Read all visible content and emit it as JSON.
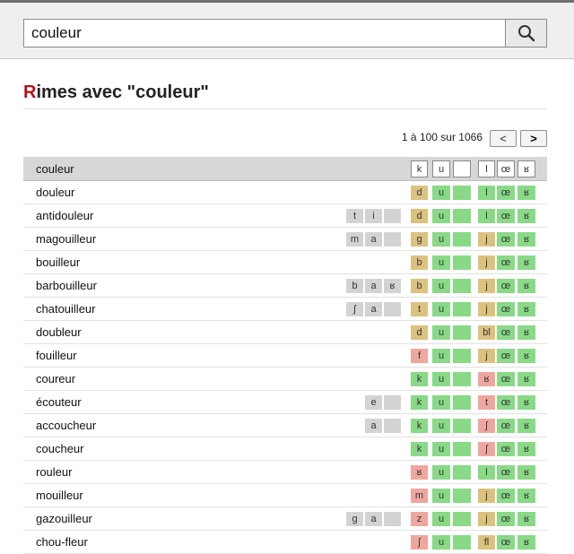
{
  "search": {
    "value": "couleur",
    "placeholder": ""
  },
  "title": {
    "first_letter": "R",
    "rest": "imes avec \"couleur\""
  },
  "pager": {
    "summary": "1 à 100 sur 1066",
    "prev_label": "<",
    "next_label": ">"
  },
  "colors": {
    "gray": "#d3d3d3",
    "tan": "#dcc27f",
    "green": "#89d987",
    "red": "#eea79f",
    "title_accent": "#b3141b"
  },
  "header_row": {
    "word": "couleur",
    "phonemes": [
      "",
      "",
      "",
      "k",
      "u",
      "",
      "l",
      "œ",
      "ʁ"
    ]
  },
  "rows": [
    {
      "word": "douleur",
      "cells": [
        [
          "",
          ""
        ],
        [
          "",
          ""
        ],
        [
          "",
          ""
        ],
        [
          "d",
          "tan"
        ],
        [
          "u",
          "green"
        ],
        [
          "",
          "green"
        ],
        [
          "l",
          "green"
        ],
        [
          "œ",
          "green"
        ],
        [
          "ʁ",
          "green"
        ]
      ]
    },
    {
      "word": "antidouleur",
      "cells": [
        [
          "t",
          "gray"
        ],
        [
          "i",
          "gray"
        ],
        [
          "",
          "gray"
        ],
        [
          "d",
          "tan"
        ],
        [
          "u",
          "green"
        ],
        [
          "",
          "green"
        ],
        [
          "l",
          "green"
        ],
        [
          "œ",
          "green"
        ],
        [
          "ʁ",
          "green"
        ]
      ]
    },
    {
      "word": "magouilleur",
      "cells": [
        [
          "m",
          "gray"
        ],
        [
          "a",
          "gray"
        ],
        [
          "",
          "gray"
        ],
        [
          "g",
          "tan"
        ],
        [
          "u",
          "green"
        ],
        [
          "",
          "green"
        ],
        [
          "j",
          "tan"
        ],
        [
          "œ",
          "green"
        ],
        [
          "ʁ",
          "green"
        ]
      ]
    },
    {
      "word": "bouilleur",
      "cells": [
        [
          "",
          ""
        ],
        [
          "",
          ""
        ],
        [
          "",
          ""
        ],
        [
          "b",
          "tan"
        ],
        [
          "u",
          "green"
        ],
        [
          "",
          "green"
        ],
        [
          "j",
          "tan"
        ],
        [
          "œ",
          "green"
        ],
        [
          "ʁ",
          "green"
        ]
      ]
    },
    {
      "word": "barbouilleur",
      "cells": [
        [
          "b",
          "gray"
        ],
        [
          "a",
          "gray"
        ],
        [
          "ʁ",
          "gray"
        ],
        [
          "b",
          "tan"
        ],
        [
          "u",
          "green"
        ],
        [
          "",
          "green"
        ],
        [
          "j",
          "tan"
        ],
        [
          "œ",
          "green"
        ],
        [
          "ʁ",
          "green"
        ]
      ]
    },
    {
      "word": "chatouilleur",
      "cells": [
        [
          "ʃ",
          "gray"
        ],
        [
          "a",
          "gray"
        ],
        [
          "",
          "gray"
        ],
        [
          "t",
          "tan"
        ],
        [
          "u",
          "green"
        ],
        [
          "",
          "green"
        ],
        [
          "j",
          "tan"
        ],
        [
          "œ",
          "green"
        ],
        [
          "ʁ",
          "green"
        ]
      ]
    },
    {
      "word": "doubleur",
      "cells": [
        [
          "",
          ""
        ],
        [
          "",
          ""
        ],
        [
          "",
          ""
        ],
        [
          "d",
          "tan"
        ],
        [
          "u",
          "green"
        ],
        [
          "",
          "green"
        ],
        [
          "bl",
          "tan"
        ],
        [
          "œ",
          "green"
        ],
        [
          "ʁ",
          "green"
        ]
      ]
    },
    {
      "word": "fouilleur",
      "cells": [
        [
          "",
          ""
        ],
        [
          "",
          ""
        ],
        [
          "",
          ""
        ],
        [
          "f",
          "red"
        ],
        [
          "u",
          "green"
        ],
        [
          "",
          "green"
        ],
        [
          "j",
          "tan"
        ],
        [
          "œ",
          "green"
        ],
        [
          "ʁ",
          "green"
        ]
      ]
    },
    {
      "word": "coureur",
      "cells": [
        [
          "",
          ""
        ],
        [
          "",
          ""
        ],
        [
          "",
          ""
        ],
        [
          "k",
          "green"
        ],
        [
          "u",
          "green"
        ],
        [
          "",
          "green"
        ],
        [
          "ʁ",
          "red"
        ],
        [
          "œ",
          "green"
        ],
        [
          "ʁ",
          "green"
        ]
      ]
    },
    {
      "word": "écouteur",
      "cells": [
        [
          "",
          ""
        ],
        [
          "e",
          "gray"
        ],
        [
          "",
          "gray"
        ],
        [
          "k",
          "green"
        ],
        [
          "u",
          "green"
        ],
        [
          "",
          "green"
        ],
        [
          "t",
          "red"
        ],
        [
          "œ",
          "green"
        ],
        [
          "ʁ",
          "green"
        ]
      ]
    },
    {
      "word": "accoucheur",
      "cells": [
        [
          "",
          ""
        ],
        [
          "a",
          "gray"
        ],
        [
          "",
          "gray"
        ],
        [
          "k",
          "green"
        ],
        [
          "u",
          "green"
        ],
        [
          "",
          "green"
        ],
        [
          "ʃ",
          "red"
        ],
        [
          "œ",
          "green"
        ],
        [
          "ʁ",
          "green"
        ]
      ]
    },
    {
      "word": "coucheur",
      "cells": [
        [
          "",
          ""
        ],
        [
          "",
          ""
        ],
        [
          "",
          ""
        ],
        [
          "k",
          "green"
        ],
        [
          "u",
          "green"
        ],
        [
          "",
          "green"
        ],
        [
          "ʃ",
          "red"
        ],
        [
          "œ",
          "green"
        ],
        [
          "ʁ",
          "green"
        ]
      ]
    },
    {
      "word": "rouleur",
      "cells": [
        [
          "",
          ""
        ],
        [
          "",
          ""
        ],
        [
          "",
          ""
        ],
        [
          "ʁ",
          "red"
        ],
        [
          "u",
          "green"
        ],
        [
          "",
          "green"
        ],
        [
          "l",
          "green"
        ],
        [
          "œ",
          "green"
        ],
        [
          "ʁ",
          "green"
        ]
      ]
    },
    {
      "word": "mouilleur",
      "cells": [
        [
          "",
          ""
        ],
        [
          "",
          ""
        ],
        [
          "",
          ""
        ],
        [
          "m",
          "red"
        ],
        [
          "u",
          "green"
        ],
        [
          "",
          "green"
        ],
        [
          "j",
          "tan"
        ],
        [
          "œ",
          "green"
        ],
        [
          "ʁ",
          "green"
        ]
      ]
    },
    {
      "word": "gazouilleur",
      "cells": [
        [
          "g",
          "gray"
        ],
        [
          "a",
          "gray"
        ],
        [
          "",
          "gray"
        ],
        [
          "z",
          "red"
        ],
        [
          "u",
          "green"
        ],
        [
          "",
          "green"
        ],
        [
          "j",
          "tan"
        ],
        [
          "œ",
          "green"
        ],
        [
          "ʁ",
          "green"
        ]
      ]
    },
    {
      "word": "chou-fleur",
      "cells": [
        [
          "",
          ""
        ],
        [
          "",
          ""
        ],
        [
          "",
          ""
        ],
        [
          "ʃ",
          "red"
        ],
        [
          "u",
          "green"
        ],
        [
          "",
          "green"
        ],
        [
          "fl",
          "tan"
        ],
        [
          "œ",
          "green"
        ],
        [
          "ʁ",
          "green"
        ]
      ]
    }
  ]
}
